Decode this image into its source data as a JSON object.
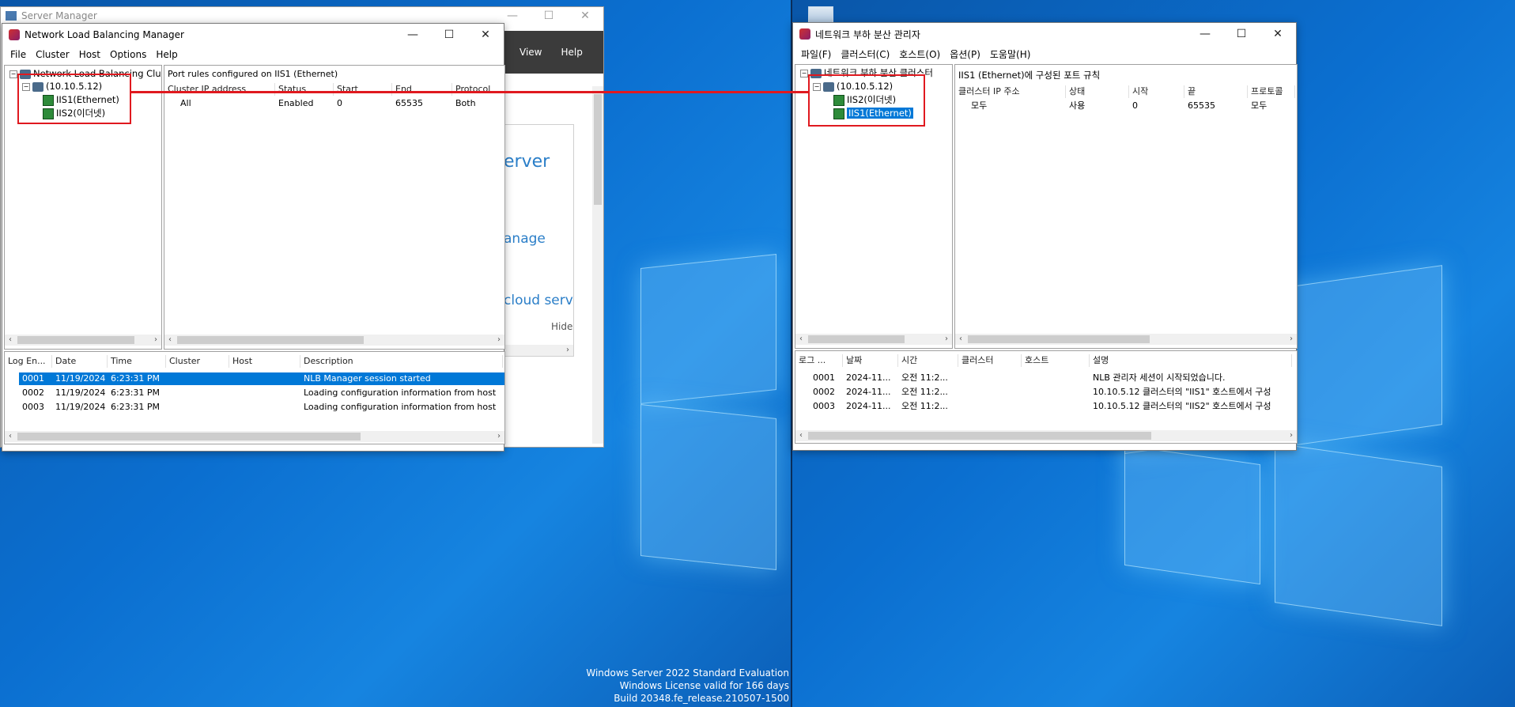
{
  "server_manager": {
    "title": "Server Manager",
    "menu_view": "View",
    "menu_help": "Help",
    "partial_text_1": "erver",
    "partial_text_2": "anage",
    "partial_text_3": "cloud servic",
    "hide_label": "Hide"
  },
  "nlb_en": {
    "title": "Network Load Balancing Manager",
    "menu": [
      "File",
      "Cluster",
      "Host",
      "Options",
      "Help"
    ],
    "tree": {
      "root": "Network Load Balancing Clus",
      "cluster": "(10.10.5.12)",
      "hosts": [
        "IIS1(Ethernet)",
        "IIS2(이더넷)"
      ]
    },
    "port_rules_title": "Port rules configured on IIS1 (Ethernet)",
    "port_headers": [
      "Cluster IP address",
      "Status",
      "Start",
      "End",
      "Protocol"
    ],
    "port_rows": [
      [
        "All",
        "Enabled",
        "0",
        "65535",
        "Both"
      ]
    ],
    "log_headers": [
      "Log En...",
      "Date",
      "Time",
      "Cluster",
      "Host",
      "Description"
    ],
    "log_rows": [
      [
        "0001",
        "11/19/2024",
        "6:23:31 PM",
        "",
        "",
        "NLB Manager session started"
      ],
      [
        "0002",
        "11/19/2024",
        "6:23:31 PM",
        "",
        "",
        "Loading configuration information from host \"I"
      ],
      [
        "0003",
        "11/19/2024",
        "6:23:31 PM",
        "",
        "",
        "Loading configuration information from host \"I"
      ]
    ]
  },
  "nlb_ko": {
    "title": "네트워크 부하 분산 관리자",
    "menu": [
      "파일(F)",
      "클러스터(C)",
      "호스트(O)",
      "옵션(P)",
      "도움말(H)"
    ],
    "tree": {
      "root": "네트워크 부하 분산 클러스터",
      "cluster": "(10.10.5.12)",
      "hosts": [
        "IIS2(이더넷)",
        "IIS1(Ethernet)"
      ]
    },
    "port_rules_title": "IIS1 (Ethernet)에 구성된 포트 규칙",
    "port_headers": [
      "클러스터 IP 주소",
      "상태",
      "시작",
      "끝",
      "프로토콜"
    ],
    "port_rows": [
      [
        "모두",
        "사용",
        "0",
        "65535",
        "모두"
      ]
    ],
    "log_headers": [
      "로그 ...",
      "날짜",
      "시간",
      "클러스터",
      "호스트",
      "설명"
    ],
    "log_rows": [
      [
        "0001",
        "2024-11...",
        "오전 11:2...",
        "",
        "",
        "NLB 관리자 세션이 시작되었습니다."
      ],
      [
        "0002",
        "2024-11...",
        "오전 11:2...",
        "",
        "",
        "10.10.5.12 클러스터의 \"IIS1\" 호스트에서 구성"
      ],
      [
        "0003",
        "2024-11...",
        "오전 11:2...",
        "",
        "",
        "10.10.5.12 클러스터의 \"IIS2\" 호스트에서 구성"
      ]
    ]
  },
  "watermark": {
    "line1": "Windows Server 2022 Standard Evaluation",
    "line2": "Windows License valid for 166 days",
    "line3": "Build 20348.fe_release.210507-1500"
  },
  "colors": {
    "selection": "#0078d7",
    "highlight_box": "#e0191f",
    "desktop": "#0b6fd0"
  }
}
